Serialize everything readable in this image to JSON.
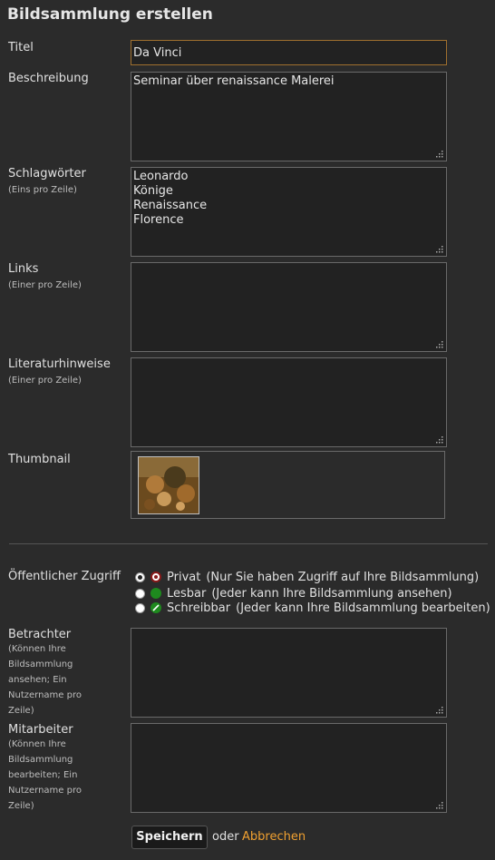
{
  "page_title": "Bildsammlung erstellen",
  "fields": {
    "titel": {
      "label": "Titel",
      "value": "Da Vinci"
    },
    "beschreibung": {
      "label": "Beschreibung",
      "value": "Seminar über renaissance Malerei"
    },
    "schlagwoerter": {
      "label": "Schlagwörter",
      "hint": "(Eins pro Zeile)",
      "value": "Leonardo\nKönige\nRenaissance\nFlorence"
    },
    "links": {
      "label": "Links",
      "hint": "(Einer pro Zeile)",
      "value": ""
    },
    "literatur": {
      "label": "Literaturhinweise",
      "hint": "(Einer pro Zeile)",
      "value": ""
    },
    "thumbnail": {
      "label": "Thumbnail"
    },
    "zugriff": {
      "label": "Öffentlicher Zugriff",
      "options": [
        {
          "name": "Privat",
          "desc": "(Nur Sie haben Zugriff auf Ihre Bildsammlung)",
          "selected": true,
          "icon": "lock-red-icon"
        },
        {
          "name": "Lesbar",
          "desc": "(Jeder kann Ihre Bildsammlung ansehen)",
          "selected": false,
          "icon": "green-dot-icon"
        },
        {
          "name": "Schreibbar",
          "desc": "(Jeder kann Ihre Bildsammlung bearbeiten)",
          "selected": false,
          "icon": "green-pencil-icon"
        }
      ]
    },
    "betrachter": {
      "label": "Betrachter",
      "hint_lines": [
        "(Können Ihre",
        "Bildsammlung",
        "ansehen; Ein",
        "Nutzername pro",
        "Zeile)"
      ],
      "value": ""
    },
    "mitarbeiter": {
      "label": "Mitarbeiter",
      "hint_lines": [
        "(Können Ihre",
        "Bildsammlung",
        "bearbeiten; Ein",
        "Nutzername pro",
        "Zeile)"
      ],
      "value": ""
    }
  },
  "actions": {
    "save": "Speichern",
    "or": "oder",
    "cancel": "Abbrechen"
  },
  "colors": {
    "background": "#2b2b2b",
    "accent": "#f0a030",
    "input_focus_border": "#a0702e"
  }
}
